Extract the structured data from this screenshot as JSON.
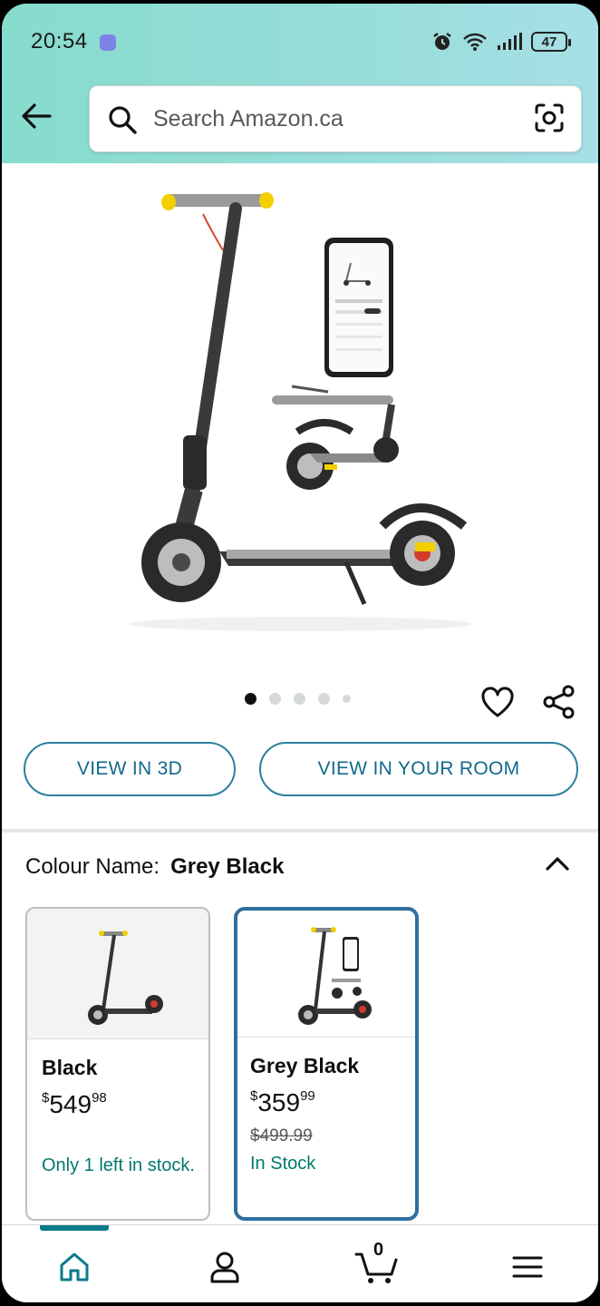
{
  "status_bar": {
    "time": "20:54",
    "battery": "47",
    "icons": [
      "app-notification-icon",
      "alarm-icon",
      "wifi-icon",
      "signal-icon",
      "battery-icon"
    ]
  },
  "header": {
    "back_icon": "arrow-left-icon",
    "search_placeholder": "Search Amazon.ca",
    "lens_icon": "camera-lens-icon"
  },
  "gallery": {
    "image_count": 5,
    "active_index": 0,
    "actions": [
      "heart-icon",
      "share-icon"
    ]
  },
  "buttons": {
    "view_3d": "VIEW IN 3D",
    "view_room": "VIEW IN YOUR ROOM"
  },
  "colour": {
    "label": "Colour Name:",
    "value": "Grey Black",
    "toggle_icon": "chevron-up-icon"
  },
  "variants": [
    {
      "name": "Black",
      "currency": "$",
      "price_whole": "549",
      "price_fraction": "98",
      "was_price": "",
      "stock": "Only 1 left in stock.",
      "selected": false
    },
    {
      "name": "Grey Black",
      "currency": "$",
      "price_whole": "359",
      "price_fraction": "99",
      "was_price": "$499.99",
      "stock": "In Stock",
      "selected": true
    }
  ],
  "bottom_nav": {
    "items": [
      "home-icon",
      "account-icon",
      "cart-icon",
      "menu-icon"
    ],
    "cart_count": "0",
    "active": "home"
  },
  "colors": {
    "header_gradient_start": "#86dccd",
    "header_gradient_end": "#a6e0e6",
    "teal_accent": "#0a7a8a",
    "pill_border": "#2a7f9e",
    "selected_border": "#2f6f9f",
    "stock_green": "#007a6b"
  }
}
